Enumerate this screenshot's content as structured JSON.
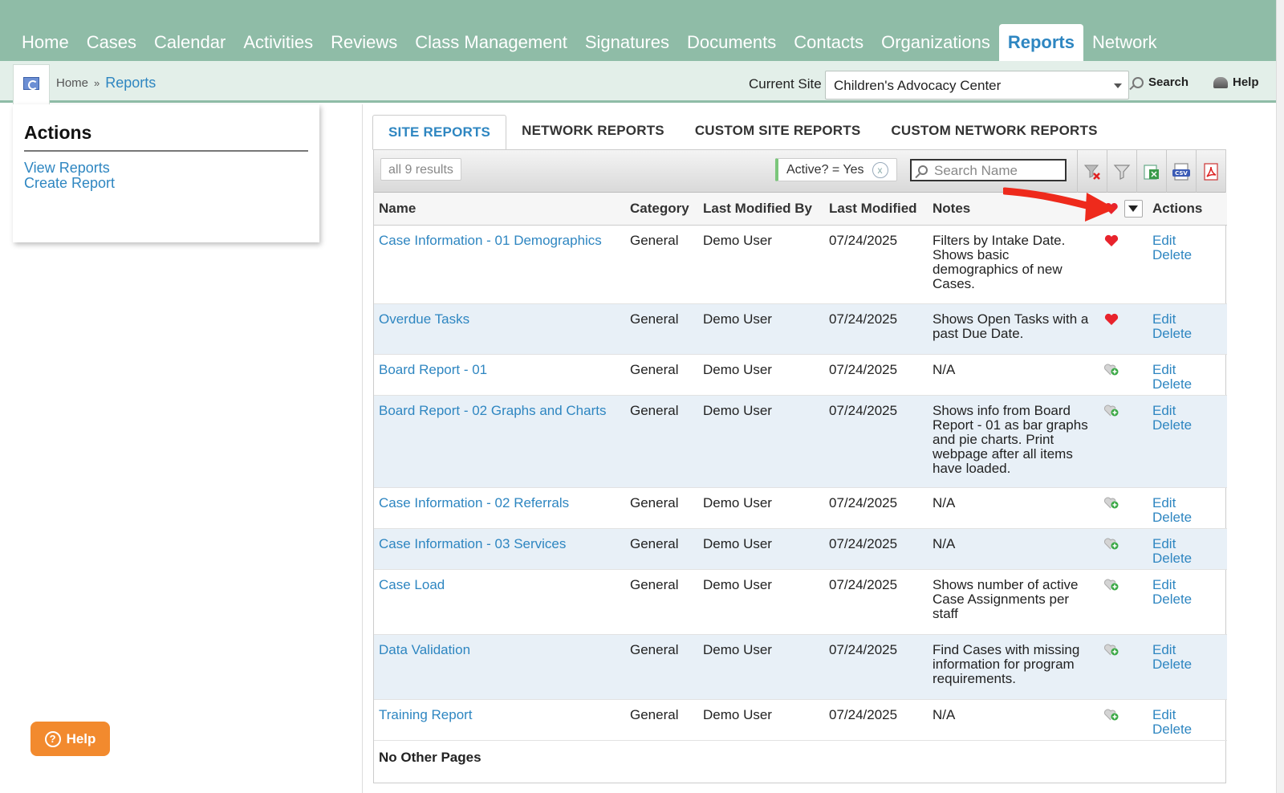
{
  "nav": {
    "items": [
      {
        "label": "Home",
        "active": false
      },
      {
        "label": "Cases",
        "active": false
      },
      {
        "label": "Calendar",
        "active": false
      },
      {
        "label": "Activities",
        "active": false
      },
      {
        "label": "Reviews",
        "active": false
      },
      {
        "label": "Class Management",
        "active": false
      },
      {
        "label": "Signatures",
        "active": false
      },
      {
        "label": "Documents",
        "active": false
      },
      {
        "label": "Contacts",
        "active": false
      },
      {
        "label": "Organizations",
        "active": false
      },
      {
        "label": "Reports",
        "active": true
      },
      {
        "label": "Network",
        "active": false
      }
    ]
  },
  "breadcrumb": {
    "home": "Home",
    "sep": "»",
    "current": "Reports"
  },
  "site": {
    "label": "Current Site",
    "value": "Children's Advocacy Center"
  },
  "subbar": {
    "search": "Search",
    "help": "Help"
  },
  "actions": {
    "title": "Actions",
    "links": [
      "View Reports",
      "Create Report"
    ]
  },
  "tabs": [
    {
      "label": "SITE REPORTS",
      "active": true
    },
    {
      "label": "NETWORK REPORTS",
      "active": false
    },
    {
      "label": "CUSTOM SITE REPORTS",
      "active": false
    },
    {
      "label": "CUSTOM NETWORK REPORTS",
      "active": false
    }
  ],
  "toolbar": {
    "results": "all 9 results",
    "filter": "Active? = Yes",
    "filter_clear": "x",
    "search_placeholder": "Search Name",
    "icons": [
      "clear-filter-icon",
      "filter-icon",
      "excel-export-icon",
      "csv-export-icon",
      "pdf-export-icon"
    ]
  },
  "table": {
    "headers": {
      "name": "Name",
      "category": "Category",
      "modified_by": "Last Modified By",
      "modified": "Last Modified",
      "notes": "Notes",
      "actions": "Actions"
    },
    "rows": [
      {
        "name": "Case Information - 01 Demographics",
        "category": "General",
        "modified_by": "Demo User",
        "modified": "07/24/2025",
        "notes": "Filters by Intake Date. Shows basic demographics of new Cases.",
        "favorite": true,
        "edit": "Edit",
        "delete": "Delete"
      },
      {
        "name": "Overdue Tasks",
        "category": "General",
        "modified_by": "Demo User",
        "modified": "07/24/2025",
        "notes": "Shows Open Tasks with a past Due Date.",
        "favorite": true,
        "edit": "Edit",
        "delete": "Delete"
      },
      {
        "name": "Board Report - 01",
        "category": "General",
        "modified_by": "Demo User",
        "modified": "07/24/2025",
        "notes": "N/A",
        "favorite": false,
        "edit": "Edit",
        "delete": "Delete"
      },
      {
        "name": "Board Report - 02 Graphs and Charts",
        "category": "General",
        "modified_by": "Demo User",
        "modified": "07/24/2025",
        "notes": "Shows info from Board Report - 01 as bar graphs and pie charts. Print webpage after all items have loaded.",
        "favorite": false,
        "edit": "Edit",
        "delete": "Delete"
      },
      {
        "name": "Case Information - 02 Referrals",
        "category": "General",
        "modified_by": "Demo User",
        "modified": "07/24/2025",
        "notes": "N/A",
        "favorite": false,
        "edit": "Edit",
        "delete": "Delete"
      },
      {
        "name": "Case Information - 03 Services",
        "category": "General",
        "modified_by": "Demo User",
        "modified": "07/24/2025",
        "notes": "N/A",
        "favorite": false,
        "edit": "Edit",
        "delete": "Delete"
      },
      {
        "name": "Case Load",
        "category": "General",
        "modified_by": "Demo User",
        "modified": "07/24/2025",
        "notes": "Shows number of active Case Assignments per staff",
        "favorite": false,
        "edit": "Edit",
        "delete": "Delete"
      },
      {
        "name": "Data Validation",
        "category": "General",
        "modified_by": "Demo User",
        "modified": "07/24/2025",
        "notes": "Find Cases with missing information for program requirements.",
        "favorite": false,
        "edit": "Edit",
        "delete": "Delete"
      },
      {
        "name": "Training Report",
        "category": "General",
        "modified_by": "Demo User",
        "modified": "07/24/2025",
        "notes": "N/A",
        "favorite": false,
        "edit": "Edit",
        "delete": "Delete"
      }
    ],
    "footer": "No Other Pages"
  },
  "help_button": "Help",
  "colors": {
    "nav_bg": "#8fbca7",
    "link": "#2e86c1",
    "alt_row": "#e8f0f7",
    "help_button": "#f28a2e",
    "arrow": "#ee2a1c",
    "favorite_on": "#e8232c"
  }
}
